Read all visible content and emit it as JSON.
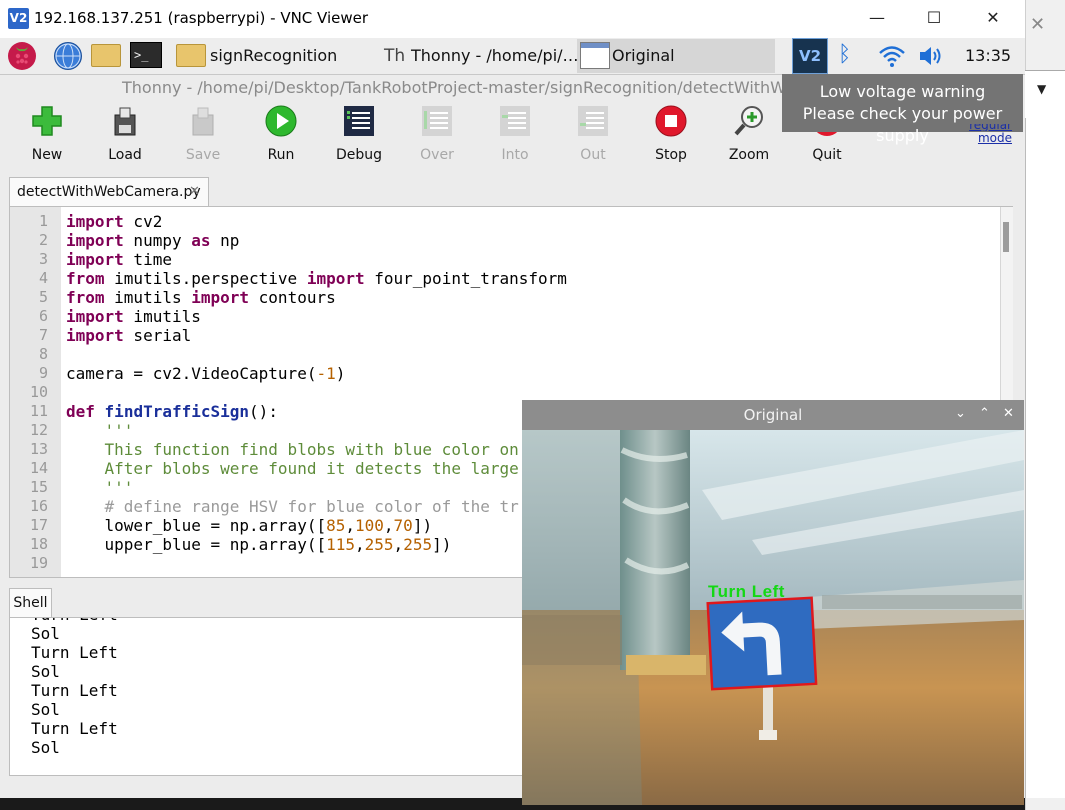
{
  "vnc": {
    "logo": "V2",
    "title": "192.168.137.251 (raspberrypi) - VNC Viewer",
    "minimize": "—",
    "maximize": "☐",
    "close": "✕",
    "side_close": "✕",
    "side_dropdown": "▼"
  },
  "taskbar": {
    "terminal_glyph": ">_",
    "items": [
      {
        "label": "signRecognition",
        "icon": "folder-icon"
      },
      {
        "label": "Thonny  -  /home/pi/…",
        "icon": "thonny-icon"
      },
      {
        "label": "Original",
        "icon": "window-icon",
        "active": true
      }
    ],
    "thonny_glyph": "Th",
    "vnc_tray": "V2",
    "bluetooth_glyph": "ᛒ",
    "clock": "13:35"
  },
  "thonny": {
    "title": "Thonny  -  /home/pi/Desktop/TankRobotProject-master/signRecognition/detectWithWebCamera.py",
    "toolbar": [
      {
        "label": "New",
        "icon": "new-icon",
        "enabled": true
      },
      {
        "label": "Load",
        "icon": "load-icon",
        "enabled": true
      },
      {
        "label": "Save",
        "icon": "save-icon",
        "enabled": false
      },
      {
        "label": "Run",
        "icon": "run-icon",
        "enabled": true
      },
      {
        "label": "Debug",
        "icon": "debug-icon",
        "enabled": true
      },
      {
        "label": "Over",
        "icon": "step-over-icon",
        "enabled": false
      },
      {
        "label": "Into",
        "icon": "step-into-icon",
        "enabled": false
      },
      {
        "label": "Out",
        "icon": "step-out-icon",
        "enabled": false
      },
      {
        "label": "Stop",
        "icon": "stop-icon",
        "enabled": true
      },
      {
        "label": "Zoom",
        "icon": "zoom-icon",
        "enabled": true
      },
      {
        "label": "Quit",
        "icon": "quit-icon",
        "enabled": true
      }
    ],
    "regular_mode_line1": "regular",
    "regular_mode_line2": "mode",
    "editor_tab": "detectWithWebCamera.py",
    "editor_tab_close": "✕",
    "line_numbers": [
      "1",
      "2",
      "3",
      "4",
      "5",
      "6",
      "7",
      "8",
      "9",
      "10",
      "11",
      "12",
      "13",
      "14",
      "15",
      "16",
      "17",
      "18",
      "19"
    ],
    "code": [
      [
        {
          "t": "import",
          "c": "kw"
        },
        {
          "t": " cv2"
        }
      ],
      [
        {
          "t": "import",
          "c": "kw"
        },
        {
          "t": " numpy "
        },
        {
          "t": "as",
          "c": "kw"
        },
        {
          "t": " np"
        }
      ],
      [
        {
          "t": "import",
          "c": "kw"
        },
        {
          "t": " time"
        }
      ],
      [
        {
          "t": "from",
          "c": "kw"
        },
        {
          "t": " imutils.perspective "
        },
        {
          "t": "import",
          "c": "kw"
        },
        {
          "t": " four_point_transform"
        }
      ],
      [
        {
          "t": "from",
          "c": "kw"
        },
        {
          "t": " imutils "
        },
        {
          "t": "import",
          "c": "kw"
        },
        {
          "t": " contours"
        }
      ],
      [
        {
          "t": "import",
          "c": "kw"
        },
        {
          "t": " imutils"
        }
      ],
      [
        {
          "t": "import",
          "c": "kw"
        },
        {
          "t": " serial"
        }
      ],
      [],
      [
        {
          "t": "camera = cv2.VideoCapture("
        },
        {
          "t": "-1",
          "c": "num"
        },
        {
          "t": ")"
        }
      ],
      [],
      [
        {
          "t": "def",
          "c": "kw"
        },
        {
          "t": " "
        },
        {
          "t": "findTrafficSign",
          "c": "fn"
        },
        {
          "t": "():"
        }
      ],
      [
        {
          "t": "    "
        },
        {
          "t": "'''",
          "c": "str"
        }
      ],
      [
        {
          "t": "    "
        },
        {
          "t": "This function find blobs with blue color on",
          "c": "str"
        }
      ],
      [
        {
          "t": "    "
        },
        {
          "t": "After blobs were found it detects the large",
          "c": "str"
        }
      ],
      [
        {
          "t": "    "
        },
        {
          "t": "'''",
          "c": "str"
        }
      ],
      [
        {
          "t": "    "
        },
        {
          "t": "# define range HSV for blue color of the tr",
          "c": "cmt"
        }
      ],
      [
        {
          "t": "    lower_blue = np.array(["
        },
        {
          "t": "85",
          "c": "num"
        },
        {
          "t": ","
        },
        {
          "t": "100",
          "c": "num"
        },
        {
          "t": ","
        },
        {
          "t": "70",
          "c": "num"
        },
        {
          "t": "])"
        }
      ],
      [
        {
          "t": "    upper_blue = np.array(["
        },
        {
          "t": "115",
          "c": "num"
        },
        {
          "t": ","
        },
        {
          "t": "255",
          "c": "num"
        },
        {
          "t": ","
        },
        {
          "t": "255",
          "c": "num"
        },
        {
          "t": "])"
        }
      ],
      []
    ],
    "shell_tab": "Shell",
    "shell_lines": [
      "Turn Left",
      "Sol",
      "Turn Left",
      "Sol",
      "Turn Left",
      "Sol",
      "Turn Left",
      "Sol"
    ]
  },
  "tooltip": {
    "line1": "Low voltage warning",
    "line2": "Please check your power supply"
  },
  "original_window": {
    "title": "Original",
    "controls": {
      "minimize": "⌄",
      "maximize": "⌃",
      "close": "✕"
    },
    "sign_label": "Turn Left",
    "label_color": "#14d814",
    "box_color": "#e0181c",
    "sign_color": "#2f6bc0"
  }
}
